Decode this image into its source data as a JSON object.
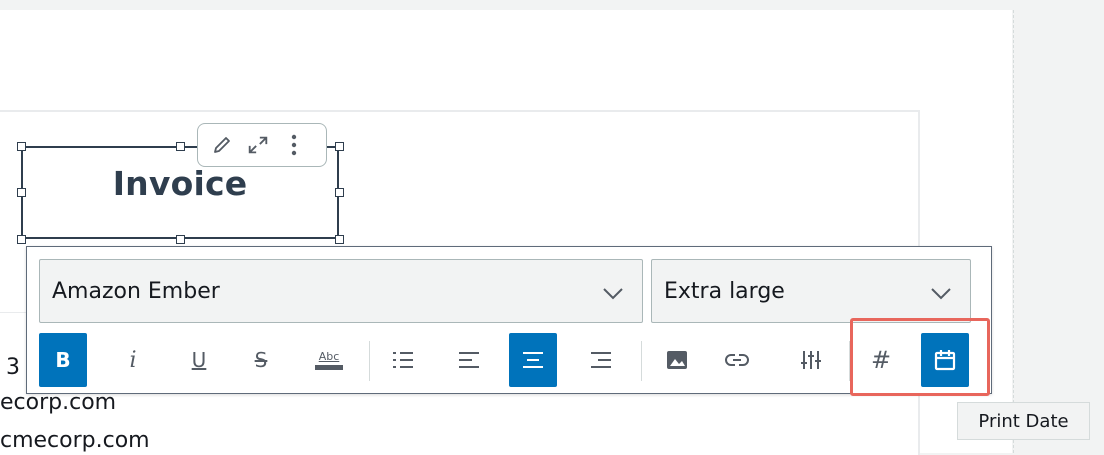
{
  "report": {
    "title": "Invoice",
    "partial_digit": "3",
    "email_line_1": "ecorp.com",
    "email_line_2": "cmecorp.com"
  },
  "mini_toolbar": {
    "icons": [
      "pencil-icon",
      "expand-icon",
      "more-vertical-icon"
    ]
  },
  "text_toolbar": {
    "font_family": {
      "value": "Amazon Ember"
    },
    "font_size": {
      "value": "Extra large"
    },
    "buttons": [
      {
        "name": "bold",
        "label": "B",
        "active": true
      },
      {
        "name": "italic",
        "label": "i",
        "active": false
      },
      {
        "name": "underline",
        "label": "U",
        "active": false
      },
      {
        "name": "strikethrough",
        "label": "S",
        "active": false
      },
      {
        "name": "text-highlight",
        "label": "Abc",
        "active": false
      },
      {
        "name": "bulleted-list",
        "active": false
      },
      {
        "name": "align-left",
        "active": false
      },
      {
        "name": "align-center",
        "active": true
      },
      {
        "name": "align-right",
        "active": false
      },
      {
        "name": "insert-image",
        "active": false
      },
      {
        "name": "insert-link",
        "active": false
      },
      {
        "name": "insert-parameter",
        "active": false
      },
      {
        "name": "page-number",
        "label": "#",
        "active": false
      },
      {
        "name": "print-date",
        "active": true
      }
    ]
  },
  "tooltip": {
    "text": "Print Date"
  },
  "colors": {
    "accent": "#0073bb",
    "highlight": "#e8665c",
    "title": "#2f3e4e"
  }
}
